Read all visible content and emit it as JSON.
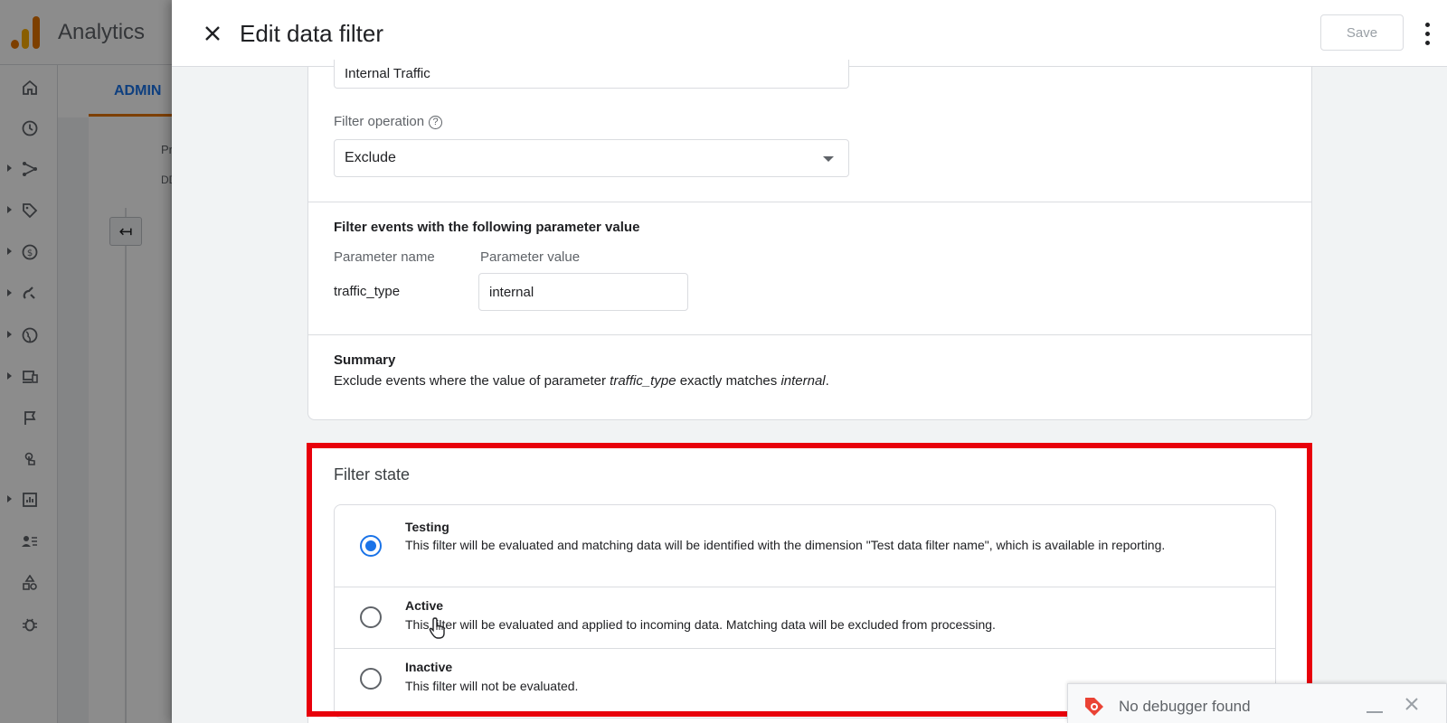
{
  "background": {
    "app_title": "Analytics",
    "tab_admin": "ADMIN",
    "col_label_1": "Pr",
    "col_label_2": "DD"
  },
  "dialog": {
    "title": "Edit data filter",
    "save_label": "Save",
    "filter_name_value": "Internal Traffic",
    "filter_operation_label": "Filter operation",
    "filter_operation_value": "Exclude",
    "params_heading": "Filter events with the following parameter value",
    "param_name_header": "Parameter name",
    "param_value_header": "Parameter value",
    "param_name": "traffic_type",
    "param_value": "internal",
    "summary_heading": "Summary",
    "summary_prefix": "Exclude events where the value of parameter ",
    "summary_param": "traffic_type",
    "summary_middle": " exactly matches ",
    "summary_value": "internal",
    "summary_suffix": ".",
    "filter_state_heading": "Filter state",
    "options": [
      {
        "title": "Testing",
        "description": "This filter will be evaluated and matching data will be identified with the dimension \"Test data filter name\", which is available in reporting.",
        "selected": true
      },
      {
        "title": "Active",
        "description": "This filter will be evaluated and applied to incoming data. Matching data will be excluded from processing.",
        "selected": false
      },
      {
        "title": "Inactive",
        "description": "This filter will not be evaluated.",
        "selected": false
      }
    ]
  },
  "toast": {
    "text": "No debugger found"
  },
  "colors": {
    "accent": "#1a73e8",
    "highlight": "#e8000b",
    "brand_orange": "#e37400"
  }
}
